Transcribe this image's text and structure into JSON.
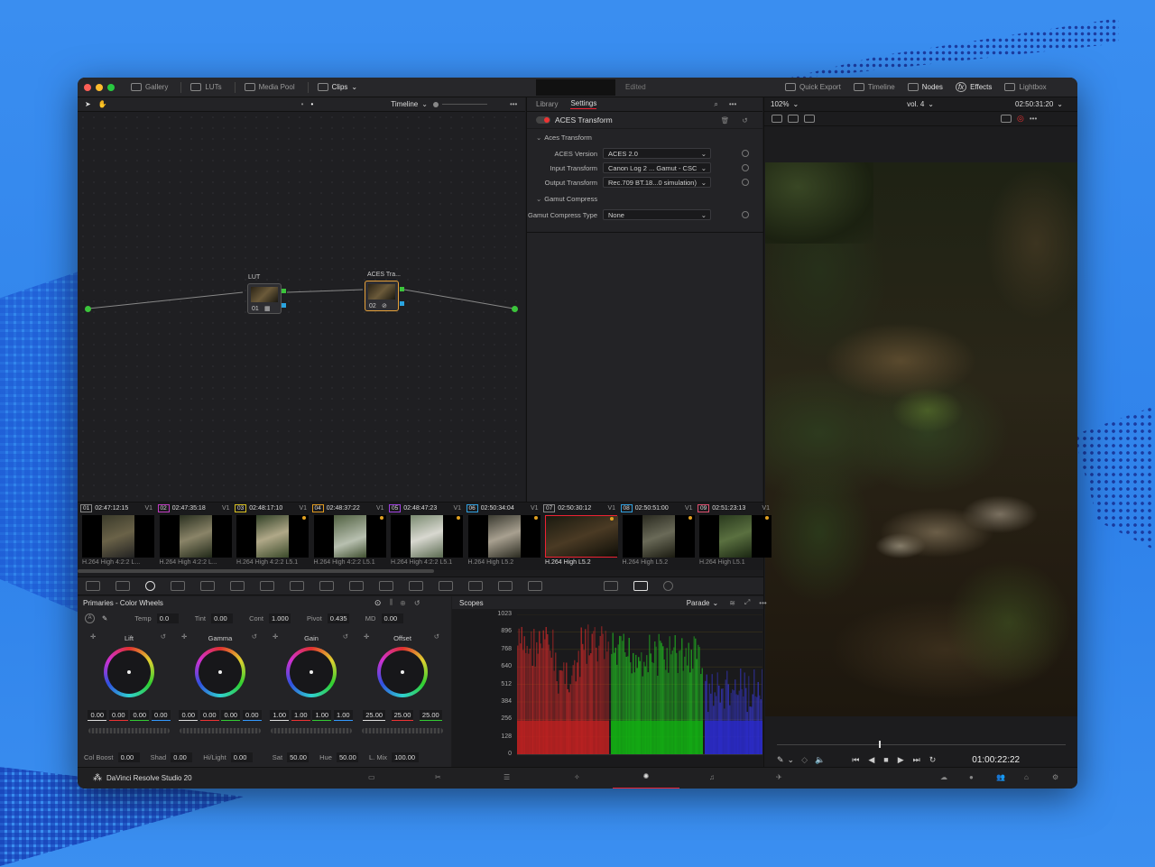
{
  "topbar": {
    "items": [
      {
        "label": "Gallery"
      },
      {
        "label": "LUTs"
      },
      {
        "label": "Media Pool"
      },
      {
        "label": "Clips"
      }
    ],
    "status": "Edited",
    "right_items": [
      {
        "label": "Quick Export"
      },
      {
        "label": "Timeline"
      },
      {
        "label": "Nodes"
      },
      {
        "label": "Effects"
      },
      {
        "label": "Lightbox"
      }
    ]
  },
  "nodebar": {
    "title": "Timeline"
  },
  "nodes": [
    {
      "label": "LUT",
      "num": "01"
    },
    {
      "label": "ACES Tra...",
      "num": "02"
    }
  ],
  "settings": {
    "tabs": [
      "Library",
      "Settings"
    ],
    "title": "ACES Transform",
    "section1": "Aces Transform",
    "rows": [
      {
        "label": "ACES Version",
        "value": "ACES 2.0"
      },
      {
        "label": "Input Transform",
        "value": "Canon Log 2 ... Gamut - CSC"
      },
      {
        "label": "Output Transform",
        "value": "Rec.709 BT.18...0 simulation)"
      }
    ],
    "section2": "Gamut Compress",
    "gamut": {
      "label": "Gamut Compress Type",
      "value": "None"
    }
  },
  "viewer": {
    "zoom": "102%",
    "clip_name": "vol. 4",
    "timecode": "02:50:31:20",
    "playhead_tc": "01:00:22:22"
  },
  "clips": [
    {
      "num": "01",
      "tc": "02:47:12:15",
      "track": "V1",
      "codec": "H.264 High 4:2:2 L..."
    },
    {
      "num": "02",
      "tc": "02:47:35:18",
      "track": "V1",
      "codec": "H.264 High 4:2:2 L..."
    },
    {
      "num": "03",
      "tc": "02:48:17:10",
      "track": "V1",
      "codec": "H.264 High 4:2:2 L5.1"
    },
    {
      "num": "04",
      "tc": "02:48:37:22",
      "track": "V1",
      "codec": "H.264 High 4:2:2 L5.1"
    },
    {
      "num": "05",
      "tc": "02:48:47:23",
      "track": "V1",
      "codec": "H.264 High 4:2:2 L5.1"
    },
    {
      "num": "06",
      "tc": "02:50:34:04",
      "track": "V1",
      "codec": "H.264 High L5.2"
    },
    {
      "num": "07",
      "tc": "02:50:30:12",
      "track": "V1",
      "codec": "H.264 High L5.2"
    },
    {
      "num": "08",
      "tc": "02:50:51:00",
      "track": "V1",
      "codec": "H.264 High L5.2"
    },
    {
      "num": "09",
      "tc": "02:51:23:13",
      "track": "V1",
      "codec": "H.264 High L5.1"
    }
  ],
  "primaries": {
    "title": "Primaries - Color Wheels",
    "params": [
      {
        "label": "Temp",
        "value": "0.0"
      },
      {
        "label": "Tint",
        "value": "0.00"
      },
      {
        "label": "Cont",
        "value": "1.000"
      },
      {
        "label": "Pivot",
        "value": "0.435"
      },
      {
        "label": "MD",
        "value": "0.00"
      }
    ],
    "wheels": [
      {
        "name": "Lift",
        "values": [
          "0.00",
          "0.00",
          "0.00",
          "0.00"
        ]
      },
      {
        "name": "Gamma",
        "values": [
          "0.00",
          "0.00",
          "0.00",
          "0.00"
        ]
      },
      {
        "name": "Gain",
        "values": [
          "1.00",
          "1.00",
          "1.00",
          "1.00"
        ]
      },
      {
        "name": "Offset",
        "values": [
          "25.00",
          "25.00",
          "25.00"
        ]
      }
    ],
    "bottom_params": [
      {
        "label": "Col Boost",
        "value": "0.00"
      },
      {
        "label": "Shad",
        "value": "0.00"
      },
      {
        "label": "Hi/Light",
        "value": "0.00"
      },
      {
        "label": "Sat",
        "value": "50.00"
      },
      {
        "label": "Hue",
        "value": "50.00"
      },
      {
        "label": "L. Mix",
        "value": "100.00"
      }
    ]
  },
  "scopes": {
    "title": "Scopes",
    "mode": "Parade",
    "ticks": [
      "1023",
      "896",
      "768",
      "640",
      "512",
      "384",
      "256",
      "128",
      "0"
    ]
  },
  "app": {
    "name": "DaVinci Resolve Studio 20"
  }
}
